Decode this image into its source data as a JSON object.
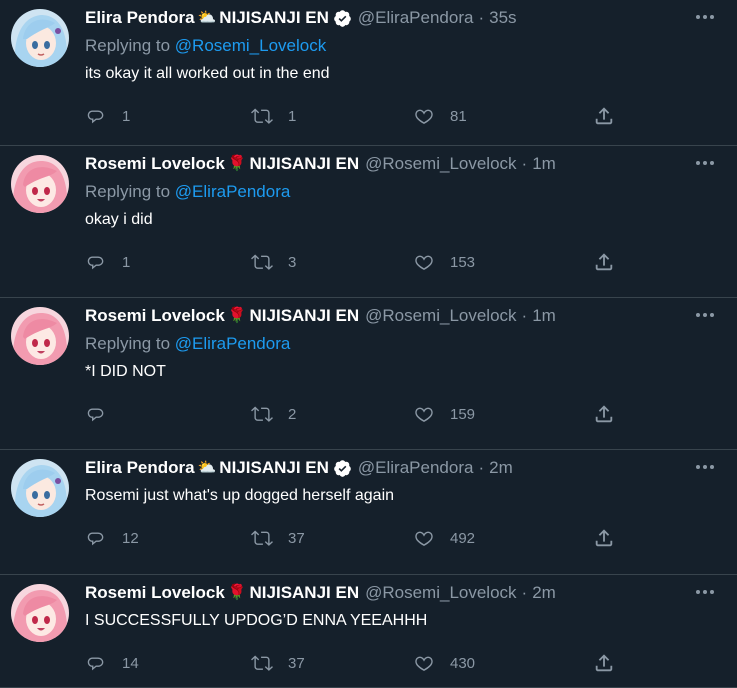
{
  "tweets": [
    {
      "avatar": "elira",
      "name": "Elira Pendora",
      "emoji": "⛅",
      "org": "NIJISANJI EN",
      "verified": true,
      "handle": "@EliraPendora",
      "time": "35s",
      "replying_prefix": "Replying to",
      "replying_to": "@Rosemi_Lovelock",
      "text": "its okay it all worked out in the end",
      "replies": "1",
      "retweets": "1",
      "likes": "81"
    },
    {
      "avatar": "rosemi",
      "name": "Rosemi Lovelock",
      "emoji": "🌹",
      "org": "NIJISANJI EN",
      "verified": false,
      "handle": "@Rosemi_Lovelock",
      "time": "1m",
      "replying_prefix": "Replying to",
      "replying_to": "@EliraPendora",
      "text": "okay i did",
      "replies": "1",
      "retweets": "3",
      "likes": "153"
    },
    {
      "avatar": "rosemi",
      "name": "Rosemi Lovelock",
      "emoji": "🌹",
      "org": "NIJISANJI EN",
      "verified": false,
      "handle": "@Rosemi_Lovelock",
      "time": "1m",
      "replying_prefix": "Replying to",
      "replying_to": "@EliraPendora",
      "text": "*I DID NOT",
      "replies": "",
      "retweets": "2",
      "likes": "159"
    },
    {
      "avatar": "elira",
      "name": "Elira Pendora",
      "emoji": "⛅",
      "org": "NIJISANJI EN",
      "verified": true,
      "handle": "@EliraPendora",
      "time": "2m",
      "replying_prefix": "",
      "replying_to": "",
      "text": "Rosemi just what's up dogged herself again",
      "replies": "12",
      "retweets": "37",
      "likes": "492"
    },
    {
      "avatar": "rosemi",
      "name": "Rosemi Lovelock",
      "emoji": "🌹",
      "org": "NIJISANJI EN",
      "verified": false,
      "handle": "@Rosemi_Lovelock",
      "time": "2m",
      "replying_prefix": "",
      "replying_to": "",
      "text": "I SUCCESSFULLY UPDOG’D ENNA YEEAHHH",
      "replies": "14",
      "retweets": "37",
      "likes": "430"
    }
  ],
  "icons": {
    "reply": "reply-icon",
    "retweet": "retweet-icon",
    "like": "heart-icon",
    "share": "share-icon",
    "more": "more-icon",
    "verified": "verified-badge-icon"
  },
  "colors": {
    "background": "#15202b",
    "divider": "#38444d",
    "secondary_text": "#8b98a5",
    "link": "#1d9bf0"
  }
}
